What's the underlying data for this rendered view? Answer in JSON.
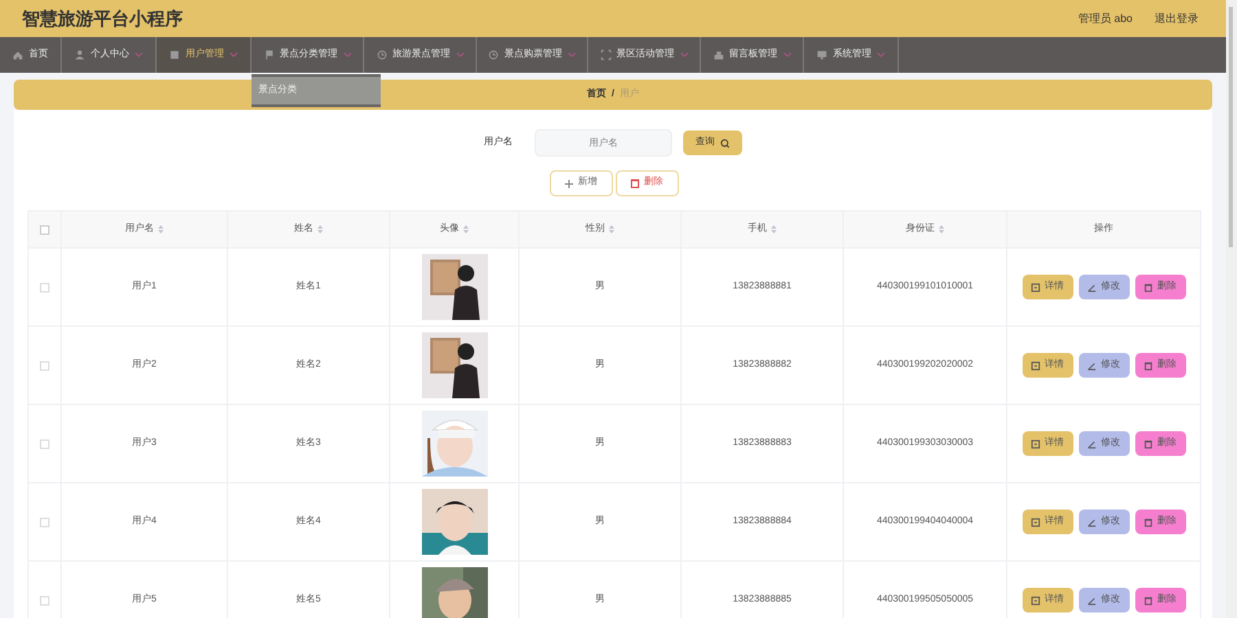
{
  "header": {
    "title": "智慧旅游平台小程序",
    "user": "管理员 abo",
    "logout": "退出登录"
  },
  "nav": [
    {
      "label": "首页",
      "caret": false,
      "selected": false
    },
    {
      "label": "个人中心",
      "caret": true,
      "selected": false
    },
    {
      "label": "用户管理",
      "caret": true,
      "selected": true
    },
    {
      "label": "景点分类管理",
      "caret": true,
      "selected": false,
      "dropdown": [
        "景点分类"
      ]
    },
    {
      "label": "旅游景点管理",
      "caret": true,
      "selected": false
    },
    {
      "label": "景点购票管理",
      "caret": true,
      "selected": false
    },
    {
      "label": "景区活动管理",
      "caret": true,
      "selected": false
    },
    {
      "label": "留言板管理",
      "caret": true,
      "selected": false
    },
    {
      "label": "系统管理",
      "caret": true,
      "selected": false
    }
  ],
  "breadcrumb": [
    "首页",
    "/",
    "用户"
  ],
  "search": {
    "label": "用户名",
    "placeholder": "用户名",
    "button": "查询"
  },
  "actions": [
    "新增",
    "删除"
  ],
  "table": {
    "columns": [
      {
        "label": "用户名",
        "sortable": true
      },
      {
        "label": "姓名",
        "sortable": true
      },
      {
        "label": "头像",
        "sortable": true
      },
      {
        "label": "性别",
        "sortable": true
      },
      {
        "label": "手机",
        "sortable": true
      },
      {
        "label": "身份证",
        "sortable": true
      },
      {
        "label": "操作",
        "sortable": false
      }
    ],
    "select_all_checked": false,
    "rows": [
      {
        "checked": false,
        "username": "用户1",
        "name": "姓名1",
        "gender": "男",
        "phone": "13823888881",
        "id_card": "440300199101010001",
        "buttons": [
          "详情",
          "修改",
          "删除"
        ]
      },
      {
        "checked": false,
        "username": "用户2",
        "name": "姓名2",
        "gender": "男",
        "phone": "13823888882",
        "id_card": "440300199202020002",
        "buttons": [
          "详情",
          "修改",
          "删除"
        ]
      },
      {
        "checked": false,
        "username": "用户3",
        "name": "姓名3",
        "gender": "男",
        "phone": "13823888883",
        "id_card": "440300199303030003",
        "buttons": [
          "详情",
          "修改",
          "删除"
        ]
      },
      {
        "checked": false,
        "username": "用户4",
        "name": "姓名4",
        "gender": "男",
        "phone": "13823888884",
        "id_card": "440300199404040004",
        "buttons": [
          "详情",
          "修改",
          "删除"
        ]
      },
      {
        "checked": false,
        "username": "用户5",
        "name": "姓名5",
        "gender": "男",
        "phone": "13823888885",
        "id_card": "440300199505050005",
        "buttons": [
          "详情",
          "修改",
          "删除"
        ]
      }
    ]
  }
}
